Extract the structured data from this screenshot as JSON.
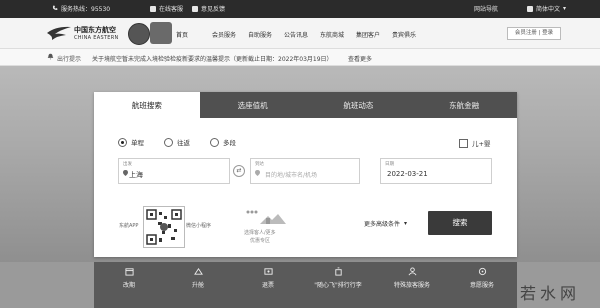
{
  "topbar": {
    "hotline_label": "服务热线：95530",
    "service_label": "在线客服",
    "feedback_label": "意见反馈",
    "site_nav_label": "网站导航",
    "language_label": "简体中文"
  },
  "header": {
    "logo_cn": "中国东方航空",
    "logo_en": "CHINA EASTERN",
    "nav": [
      "首页",
      "会员服务",
      "自助服务",
      "公告讯息",
      "东航商城",
      "集团客户",
      "贵宾俱乐"
    ],
    "login_label": "会员注册 | 登录"
  },
  "notice": {
    "label": "出行提示",
    "text": "关于境航空暂未完成入境检验检疫新要求的温馨提示（更新截止日期：2022年03月19日）",
    "more": "查看更多"
  },
  "booking": {
    "tabs": [
      "航班搜索",
      "选座值机",
      "航班动态",
      "东航金融"
    ],
    "trip_types": [
      "单程",
      "往返",
      "多段"
    ],
    "selected_trip": "单程",
    "infant_label": "儿+婴",
    "from_caption": "出发",
    "from_value": "上海",
    "to_caption": "到达",
    "to_placeholder": "目的地/城市名/机场",
    "date_caption": "日期",
    "date_value": "2022-03-21",
    "qr_label": "东航APP",
    "mini_label": "微信小程序",
    "promo_line1": "选择客人/更多",
    "promo_line2": "优惠专区",
    "advanced_label": "更多高级条件",
    "search_label": "搜索"
  },
  "bottom_items": [
    {
      "label": "改期",
      "icon": "calendar-icon"
    },
    {
      "label": "升舱",
      "icon": "upgrade-icon"
    },
    {
      "label": "退票",
      "icon": "ticket-icon"
    },
    {
      "label": "\"随心飞\"排行行李",
      "icon": "luggage-icon"
    },
    {
      "label": "特殊旅客服务",
      "icon": "passenger-icon"
    },
    {
      "label": "意愿服务",
      "icon": "service-icon"
    }
  ],
  "watermark": "若水网"
}
